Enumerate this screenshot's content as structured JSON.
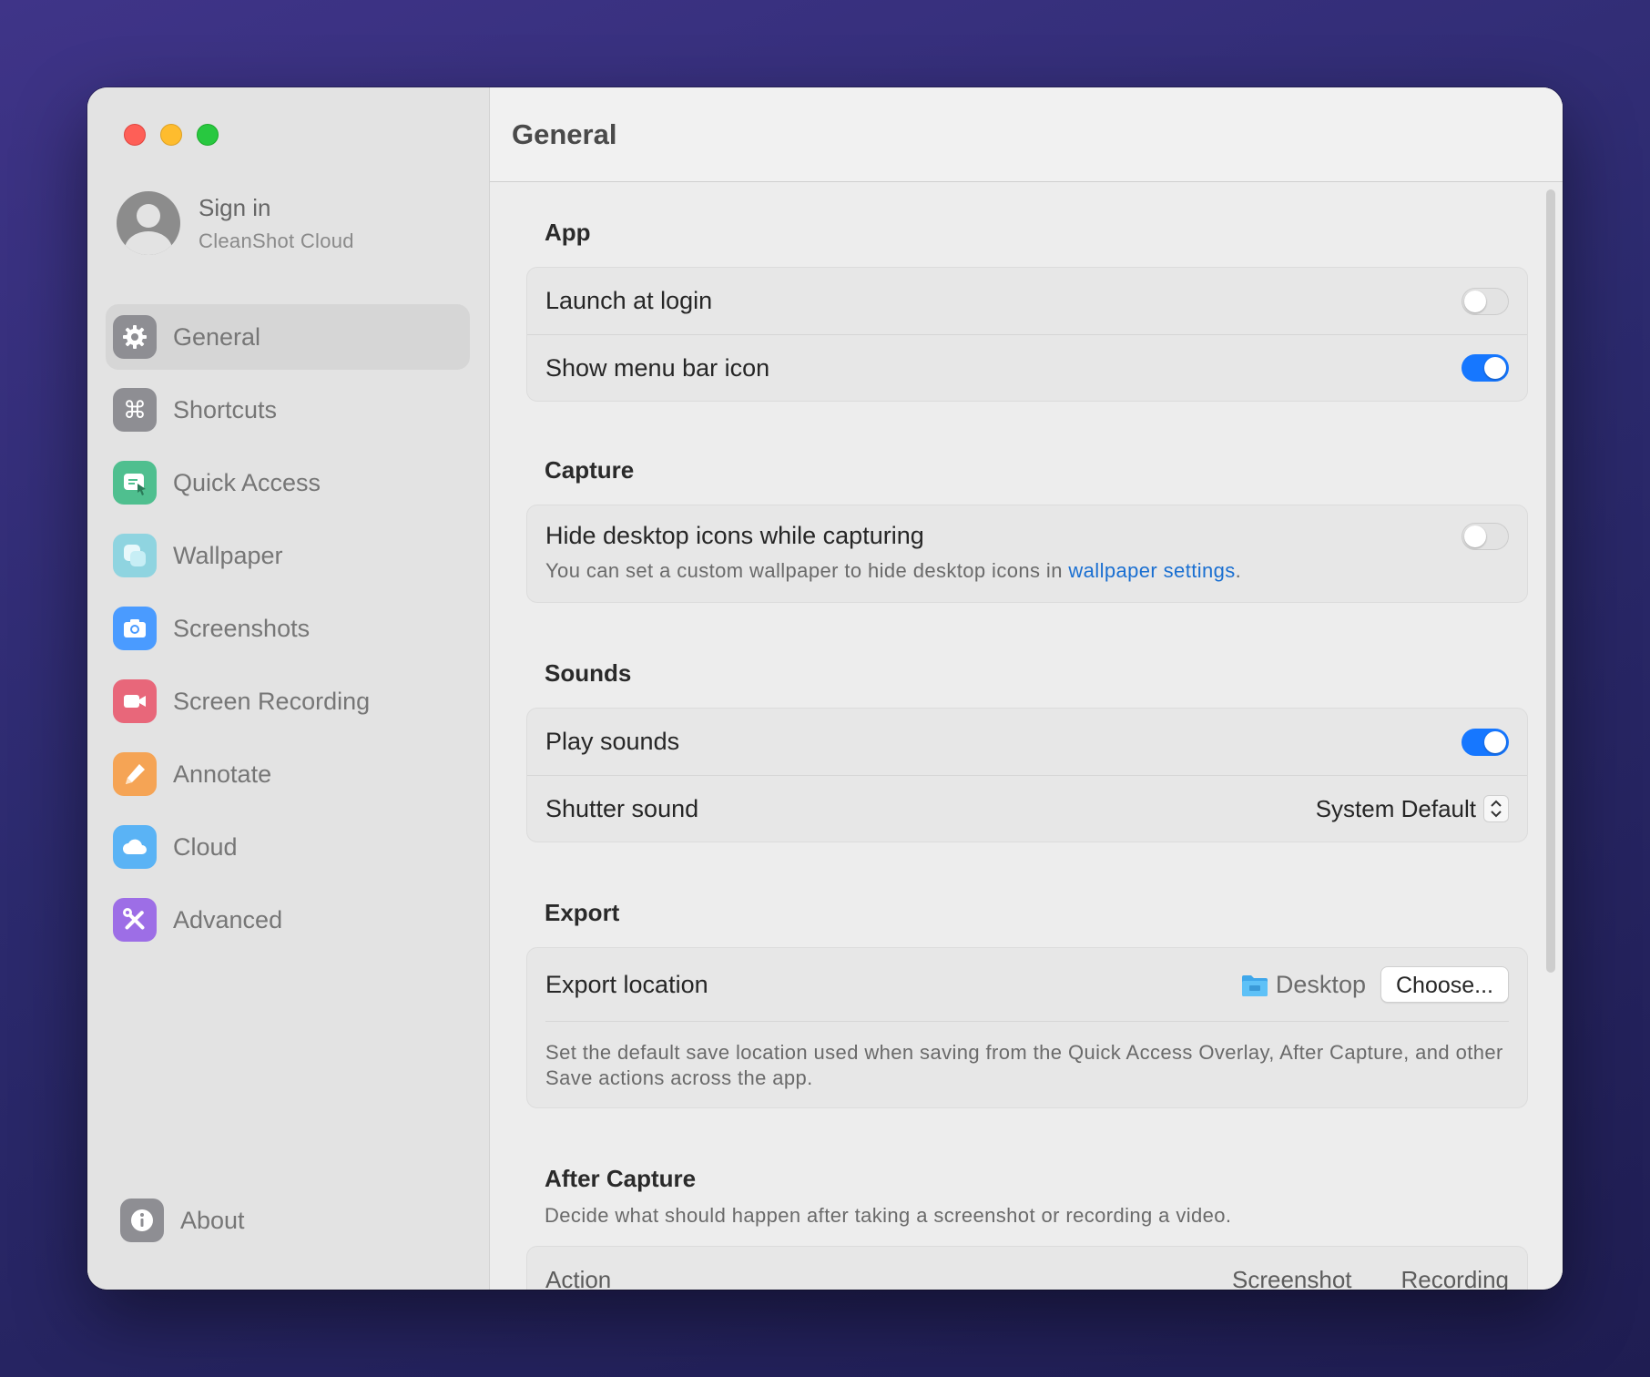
{
  "window": {
    "traffic_lights": [
      "close",
      "minimize",
      "zoom"
    ]
  },
  "account": {
    "title": "Sign in",
    "subtitle": "CleanShot Cloud",
    "icon": "person-icon"
  },
  "sidebar": {
    "items": [
      {
        "label": "General",
        "icon": "gear-icon",
        "color": "#8e8e93",
        "active": true
      },
      {
        "label": "Shortcuts",
        "icon": "command-icon",
        "color": "#8e8e93"
      },
      {
        "label": "Quick Access",
        "icon": "quick-access-icon",
        "color": "#4fbf8f"
      },
      {
        "label": "Wallpaper",
        "icon": "wallpaper-icon",
        "color": "#8fd4e0"
      },
      {
        "label": "Screenshots",
        "icon": "camera-icon",
        "color": "#4a9bff"
      },
      {
        "label": "Screen Recording",
        "icon": "video-camera-icon",
        "color": "#e8677a"
      },
      {
        "label": "Annotate",
        "icon": "pencil-icon",
        "color": "#f5a455"
      },
      {
        "label": "Cloud",
        "icon": "cloud-icon",
        "color": "#5ab3f5"
      },
      {
        "label": "Advanced",
        "icon": "wrench-screwdriver-icon",
        "color": "#9d6ee6"
      }
    ],
    "about": {
      "label": "About",
      "icon": "info-icon",
      "color": "#8e8e93"
    }
  },
  "main": {
    "title": "General",
    "sections": {
      "app": {
        "title": "App",
        "launch_at_login": {
          "label": "Launch at login",
          "on": false
        },
        "show_menu_bar_icon": {
          "label": "Show menu bar icon",
          "on": true
        }
      },
      "capture": {
        "title": "Capture",
        "hide_desktop_icons": {
          "label": "Hide desktop icons while capturing",
          "on": false
        },
        "hint_prefix": "You can set a custom wallpaper to hide desktop icons in ",
        "hint_link": "wallpaper settings",
        "hint_suffix": "."
      },
      "sounds": {
        "title": "Sounds",
        "play_sounds": {
          "label": "Play sounds",
          "on": true
        },
        "shutter_sound": {
          "label": "Shutter sound",
          "value": "System Default"
        }
      },
      "export": {
        "title": "Export",
        "export_location": {
          "label": "Export location",
          "folder": "Desktop",
          "button": "Choose..."
        },
        "hint": "Set the default save location used when saving from the Quick Access Overlay, After Capture, and other Save actions across the app."
      },
      "after_capture": {
        "title": "After Capture",
        "subtitle": "Decide what should happen after taking a screenshot or recording a video.",
        "columns": [
          "Action",
          "Screenshot",
          "Recording"
        ]
      }
    }
  },
  "colors": {
    "accent": "#1677ff",
    "link": "#1a6fd1"
  }
}
